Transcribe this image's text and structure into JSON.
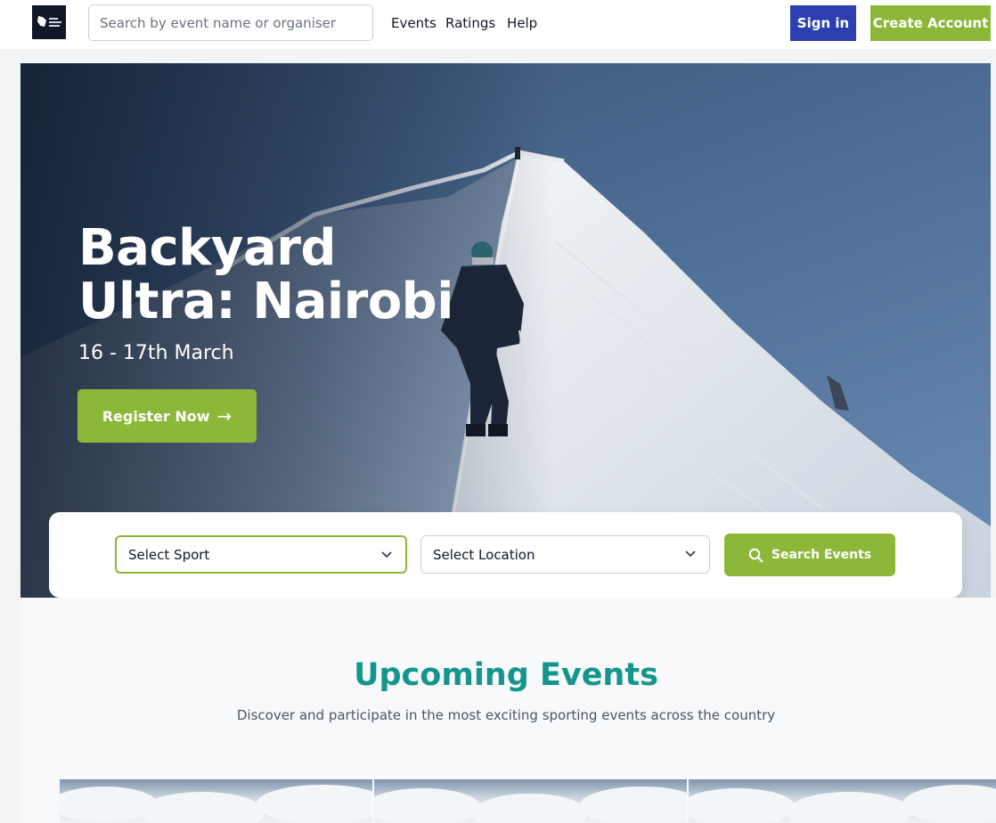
{
  "header": {
    "search_placeholder": "Search by event name or organiser",
    "nav": [
      "Events",
      "Ratings",
      "Help"
    ],
    "sign_in_label": "Sign in",
    "create_account_label": "Create Account"
  },
  "hero": {
    "title": "Backyard Ultra: Nairobi",
    "date": "16 - 17th March",
    "register_label": "Register Now",
    "register_icon": "arrow-right-icon"
  },
  "filters": {
    "sport_placeholder": "Select Sport",
    "location_placeholder": "Select Location",
    "search_button_label": "Search Events",
    "search_icon": "search-icon"
  },
  "upcoming": {
    "title": "Upcoming Events",
    "subtitle": "Discover and participate in the most exciting sporting events across the country"
  },
  "colors": {
    "brand_green": "#8cb739",
    "sign_in_blue": "#2b3fae",
    "heading_teal": "#14958d",
    "logo_dark": "#101828"
  }
}
